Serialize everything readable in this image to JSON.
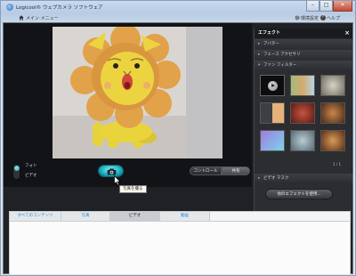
{
  "window": {
    "title": "Logicool® ウェブカメラ ソフトウェア",
    "buttons": {
      "minimize": "–",
      "maximize": "□",
      "close": "✕"
    }
  },
  "menu": {
    "main_menu": "メイン メニュー",
    "settings": "環境設定",
    "help": "ヘルプ"
  },
  "capture": {
    "photo_label": "フォト",
    "video_label": "ビデオ",
    "mode": "photo",
    "tooltip": "写真を撮る",
    "control_label": "コントロール",
    "sharing_label": "共有"
  },
  "effects": {
    "title": "エフェクト",
    "close": "×",
    "sections": [
      "アバター",
      "フェース アクセサリ",
      "ファン フィルター",
      "ビデオ マスク"
    ],
    "page_indicator": "1 / 1",
    "more_button": "他のエフェクトを使用..."
  },
  "gallery": {
    "tabs": [
      "すべてのコンテンツ",
      "写真",
      "ビデオ",
      "動画"
    ],
    "active_tab": "ビデオ"
  },
  "colors": {
    "accent": "#17a9ba",
    "app_background": "#1f2125",
    "link": "#2a86d6"
  }
}
